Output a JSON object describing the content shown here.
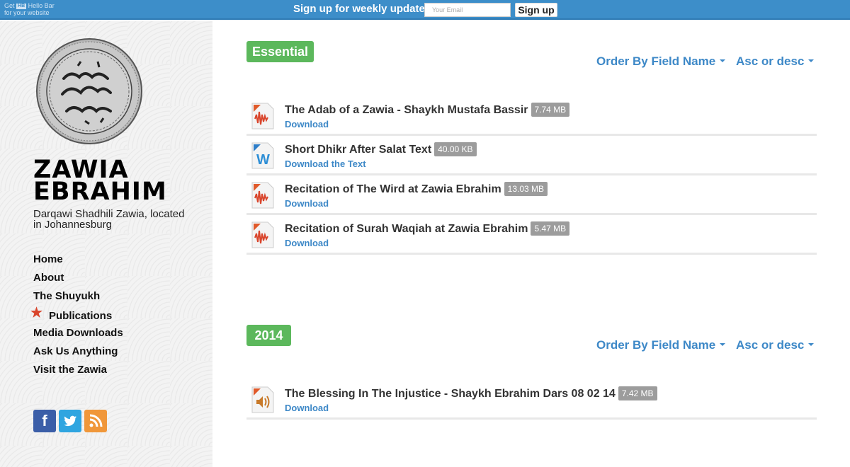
{
  "hellobar": {
    "brand_line1_pre": "Get",
    "brand_logo": "HB",
    "brand_line1_post": "Hello Bar",
    "brand_line2": "for your website",
    "text": "Sign up for weekly updates:",
    "email_placeholder": "Your Email",
    "button_label": "Sign up",
    "color": "#3d8ec9"
  },
  "sidebar": {
    "title_line1": "ZAWIA",
    "title_line2": "EBRAHIM",
    "description": "Darqawi Shadhili Zawia, located in Johannesburg",
    "nav": [
      {
        "label": "Home"
      },
      {
        "label": "About"
      },
      {
        "label": "The Shuyukh"
      },
      {
        "label": "Publications",
        "active": true,
        "icon": "star-icon"
      },
      {
        "label": "Media Downloads"
      },
      {
        "label": "Ask Us Anything"
      },
      {
        "label": "Visit the Zawia"
      }
    ],
    "social": [
      {
        "name": "facebook-icon",
        "glyph": "f",
        "color": "#3b5ea8"
      },
      {
        "name": "twitter-icon",
        "color": "#2fa5e0"
      },
      {
        "name": "rss-icon",
        "color": "#f0973a"
      }
    ]
  },
  "sections": [
    {
      "label": "Essential",
      "order_label": "Order By Field Name",
      "dir_label": "Asc or desc",
      "files": [
        {
          "title": "The Adab of a Zawia - Shaykh Mustafa Bassir",
          "size": "7.74 MB",
          "link": "Download",
          "icon": "audio-file-icon"
        },
        {
          "title": "Short Dhikr After Salat Text",
          "size": "40.00 KB",
          "link": "Download the Text",
          "icon": "word-file-icon"
        },
        {
          "title": "Recitation of The Wird at Zawia Ebrahim",
          "size": "13.03 MB",
          "link": "Download",
          "icon": "audio-file-icon"
        },
        {
          "title": "Recitation of Surah Waqiah at Zawia Ebrahim",
          "size": "5.47 MB",
          "link": "Download",
          "icon": "audio-file-icon"
        }
      ]
    },
    {
      "label": "2014",
      "order_label": "Order By Field Name",
      "dir_label": "Asc or desc",
      "files": [
        {
          "title": "The Blessing In The Injustice - Shaykh Ebrahim Dars 08 02 14",
          "size": "7.42 MB",
          "link": "Download",
          "icon": "speaker-file-icon"
        }
      ]
    }
  ],
  "colors": {
    "badge": "#5cb85c",
    "link": "#3d88c7",
    "size_badge": "#9c9c9c"
  }
}
